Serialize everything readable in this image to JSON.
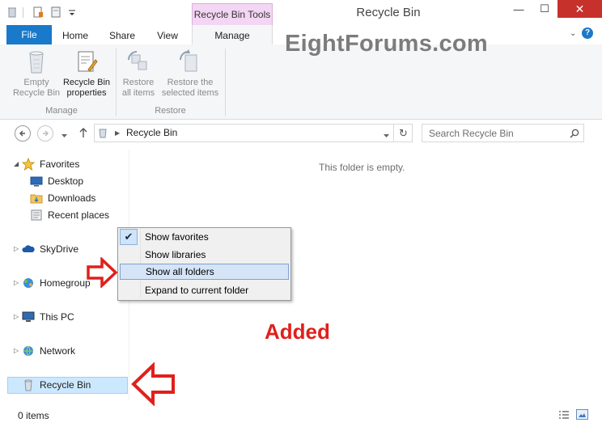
{
  "titlebar": {
    "title": "Recycle Bin",
    "context_tab_group": "Recycle Bin Tools",
    "minimize": "—",
    "maximize": "☐",
    "close": "✕"
  },
  "ribbon": {
    "tabs": {
      "file": "File",
      "home": "Home",
      "share": "Share",
      "view": "View",
      "manage": "Manage"
    },
    "buttons": {
      "empty_l1": "Empty",
      "empty_l2": "Recycle Bin",
      "props_l1": "Recycle Bin",
      "props_l2": "properties",
      "restore_all_l1": "Restore",
      "restore_all_l2": "all items",
      "restore_sel_l1": "Restore the",
      "restore_sel_l2": "selected items"
    },
    "groups": {
      "manage": "Manage",
      "restore": "Restore"
    }
  },
  "watermark": "EightForums.com",
  "address": {
    "path": "Recycle Bin",
    "search_placeholder": "Search Recycle Bin"
  },
  "nav_pane": {
    "favorites": "Favorites",
    "desktop": "Desktop",
    "downloads": "Downloads",
    "recent": "Recent places",
    "skydrive": "SkyDrive",
    "homegroup": "Homegroup",
    "thispc": "This PC",
    "network": "Network",
    "recyclebin": "Recycle Bin"
  },
  "content": {
    "empty_message": "This folder is empty."
  },
  "context_menu": {
    "show_favorites": "Show favorites",
    "show_libraries": "Show libraries",
    "show_all_folders": "Show all folders",
    "expand_current": "Expand to current folder"
  },
  "annotation": {
    "added": "Added"
  },
  "status": {
    "items": "0 items"
  },
  "colors": {
    "accent": "#1979ca",
    "context_tab": "#f3d6f3",
    "close": "#c7312b",
    "annotation": "#e0201b",
    "selection": "#cce8ff"
  }
}
